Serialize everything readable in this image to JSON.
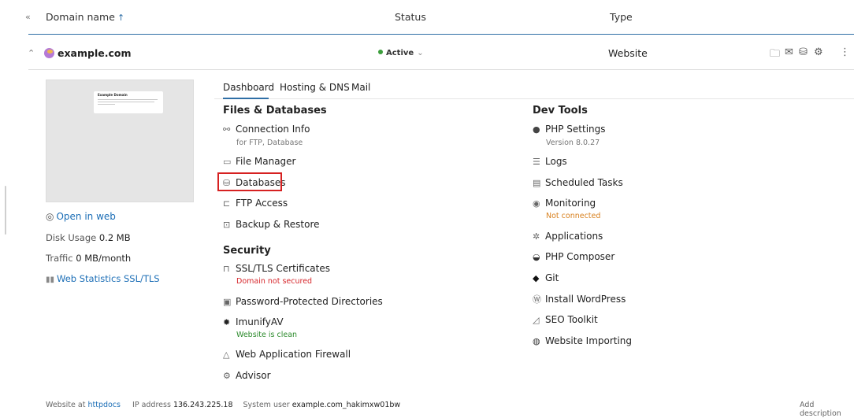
{
  "header": {
    "domain_name_label": "Domain name",
    "sort_arrow": "↑",
    "status_label": "Status",
    "type_label": "Type"
  },
  "row": {
    "domain": "example.com",
    "status": "Active",
    "type": "Website"
  },
  "preview": {
    "title": "Example Domain"
  },
  "left": {
    "open_in_web": "Open in web",
    "disk_usage_label": "Disk Usage",
    "disk_usage_value": "0.2 MB",
    "traffic_label": "Traffic",
    "traffic_value": "0 MB/month",
    "web_stats": "Web Statistics SSL/TLS"
  },
  "tabs": [
    {
      "label": "Dashboard"
    },
    {
      "label": "Hosting & DNS"
    },
    {
      "label": "Mail"
    }
  ],
  "files_db": {
    "title": "Files & Databases",
    "connection_info": "Connection Info",
    "connection_info_sub": "for FTP, Database",
    "file_manager": "File Manager",
    "databases": "Databases",
    "ftp_access": "FTP Access",
    "backup": "Backup & Restore"
  },
  "security": {
    "title": "Security",
    "ssl": "SSL/TLS Certificates",
    "ssl_sub": "Domain not secured",
    "ppd": "Password-Protected Directories",
    "imunify": "ImunifyAV",
    "imunify_sub": "Website is clean",
    "waf": "Web Application Firewall",
    "advisor": "Advisor"
  },
  "dev_tools": {
    "title": "Dev Tools",
    "php_settings": "PHP Settings",
    "php_version": "Version 8.0.27",
    "logs": "Logs",
    "scheduled_tasks": "Scheduled Tasks",
    "monitoring": "Monitoring",
    "monitoring_sub": "Not connected",
    "applications": "Applications",
    "php_composer": "PHP Composer",
    "git": "Git",
    "install_wp": "Install WordPress",
    "seo_toolkit": "SEO Toolkit",
    "website_importing": "Website Importing"
  },
  "footer": {
    "website_at_label": "Website at",
    "website_at_value": "httpdocs",
    "ip_label": "IP address",
    "ip_value": "136.243.225.18",
    "sys_user_label": "System user",
    "sys_user_value": "example.com_hakimxw01bw",
    "add_description": "Add description"
  }
}
